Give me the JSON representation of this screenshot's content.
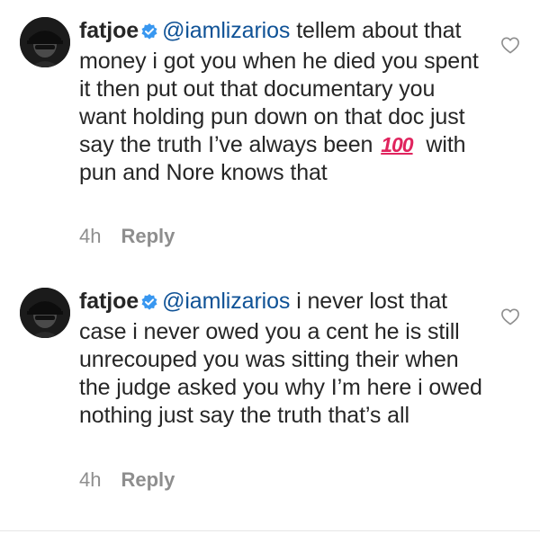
{
  "comments": [
    {
      "username": "fatjoe",
      "mention": "@iamlizarios",
      "text_before_emoji": " tellem about that money i got you when he died you spent it then put out that documentary you want holding pun down on that doc just say the truth I’ve always been ",
      "emoji": "💯",
      "text_after_emoji": " with pun and Nore knows that",
      "time": "4h",
      "reply_label": "Reply",
      "icons": {
        "avatar": "avatar-image",
        "verified": "verified-badge-icon",
        "like": "heart-icon"
      }
    },
    {
      "username": "fatjoe",
      "mention": "@iamlizarios",
      "text": " i never lost that case i never owed you a cent he is still unrecouped you was sitting their when the judge asked you why I’m here i owed nothing just say the truth that’s all",
      "time": "4h",
      "reply_label": "Reply",
      "icons": {
        "avatar": "avatar-image",
        "verified": "verified-badge-icon",
        "like": "heart-icon"
      }
    }
  ],
  "colors": {
    "text": "#262626",
    "mention": "#0f5296",
    "meta": "#8e8e8e",
    "verified": "#3897f0",
    "emoji": "#e0245e"
  }
}
